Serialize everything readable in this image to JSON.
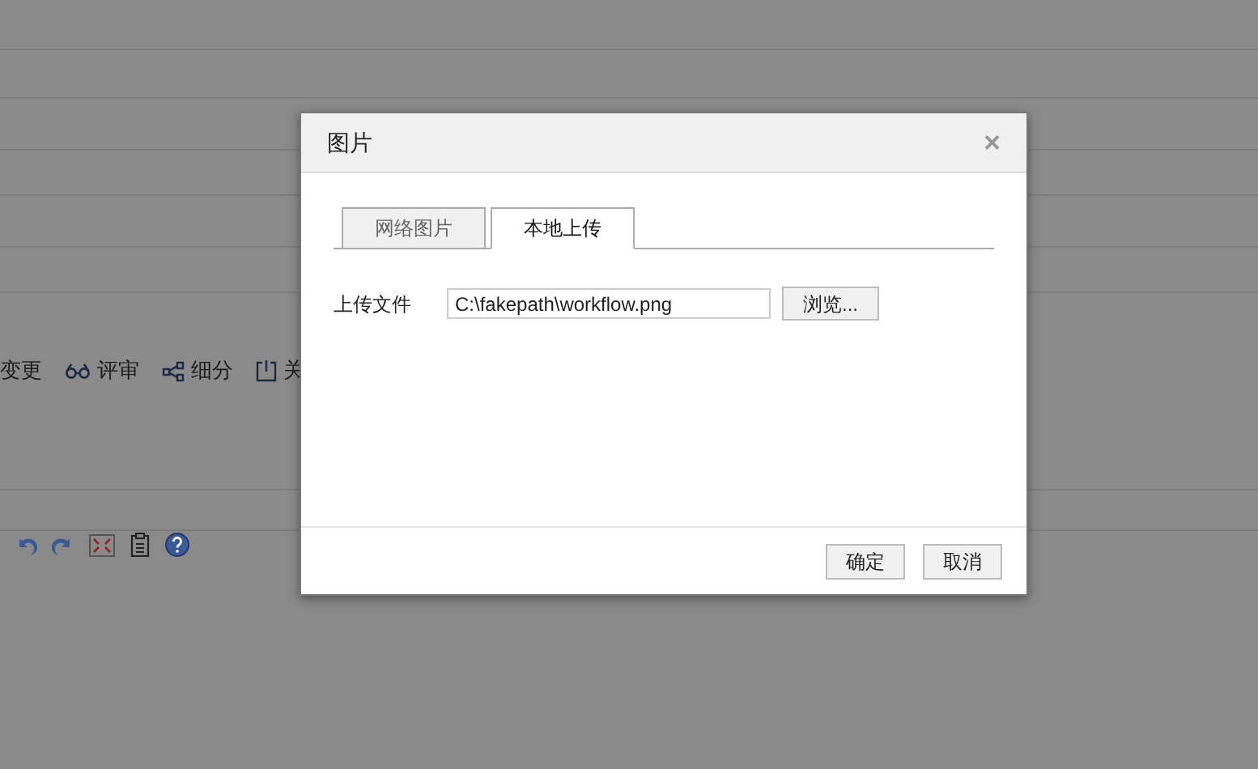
{
  "background": {
    "actions": [
      "变更",
      "评审",
      "细分",
      "关"
    ]
  },
  "dialog": {
    "title": "图片",
    "close": "×",
    "tabs": [
      {
        "label": "网络图片",
        "selected": false
      },
      {
        "label": "本地上传",
        "selected": true
      }
    ],
    "field": {
      "label": "上传文件",
      "value": "C:\\fakepath\\workflow.png"
    },
    "browse": "浏览...",
    "buttons": [
      "确定",
      "取消"
    ]
  }
}
